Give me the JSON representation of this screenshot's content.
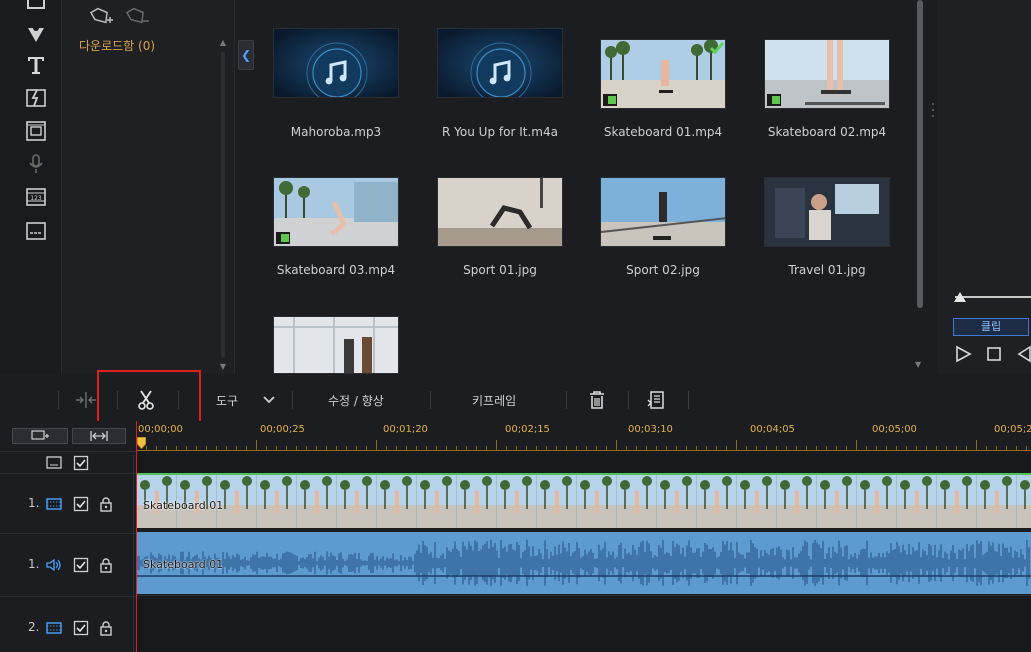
{
  "library": {
    "downloads_label": "다운로드함 (0)"
  },
  "media_items": [
    {
      "name": "Mahoroba.mp3",
      "kind": "audio"
    },
    {
      "name": "R You Up for It.m4a",
      "kind": "audio"
    },
    {
      "name": "Skateboard 01.mp4",
      "kind": "video",
      "in_use": true
    },
    {
      "name": "Skateboard 02.mp4",
      "kind": "video"
    },
    {
      "name": "Skateboard 03.mp4",
      "kind": "video"
    },
    {
      "name": "Sport 01.jpg",
      "kind": "image"
    },
    {
      "name": "Sport 02.jpg",
      "kind": "image"
    },
    {
      "name": "Travel 01.jpg",
      "kind": "image"
    },
    {
      "name": "",
      "kind": "image"
    }
  ],
  "preview": {
    "clip_button": "클립"
  },
  "toolbar": {
    "tools_label": "도구",
    "edit_label": "수정 / 향상",
    "keyframe_label": "키프레임"
  },
  "timeline": {
    "ruler": [
      "00;00;00",
      "00;00;25",
      "00;01;20",
      "00;02;15",
      "00;03;10",
      "00;04;05",
      "00;05;00",
      "00;05;2"
    ],
    "tracks": [
      {
        "number": "1.",
        "kind": "video",
        "clip": "Skateboard 01"
      },
      {
        "number": "1.",
        "kind": "audio",
        "clip": "Skateboard 01"
      },
      {
        "number": "2.",
        "kind": "video",
        "clip": ""
      }
    ]
  },
  "colors": {
    "accent_blue": "#3f7bd4",
    "ruler_gold": "#e0b04a",
    "highlight_red": "#e11d1d",
    "video_clip": "#7fb6d8",
    "audio_clip": "#5d9ad0"
  }
}
